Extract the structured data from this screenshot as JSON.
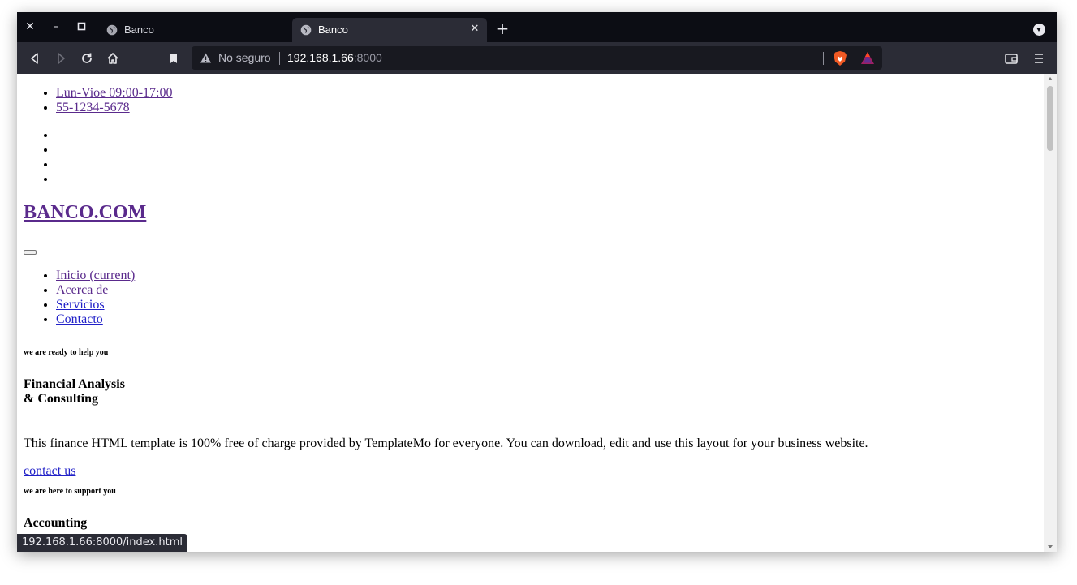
{
  "browser": {
    "tabs": [
      {
        "title": "Banco",
        "active": false
      },
      {
        "title": "Banco",
        "active": true
      }
    ],
    "url_security": "No seguro",
    "url_host": "192.168.1.66",
    "url_port": ":8000",
    "status_url": "192.168.1.66:8000/index.html"
  },
  "page": {
    "contact_items": [
      "Lun-Vioe 09:00-17:00",
      "55-1234-5678"
    ],
    "social_items_count": 4,
    "logo": "BANCO.COM",
    "nav": [
      "Inicio (current)",
      "Acerca de",
      "Servicios",
      "Contacto"
    ],
    "slide1": {
      "kicker": "we are ready to help you",
      "title_line1": "Financial Analysis",
      "title_line2": "& Consulting",
      "text": "This finance HTML template is 100% free of charge provided by TemplateMo for everyone. You can download, edit and use this layout for your business website.",
      "link": "contact us"
    },
    "slide2": {
      "kicker": "we are here to support you",
      "title": "Accounting"
    }
  },
  "colors": {
    "tabbar": "#0c0d14",
    "toolbar": "#2b2c36",
    "visited_link": "#5a2a8c",
    "link": "#2020c8"
  }
}
